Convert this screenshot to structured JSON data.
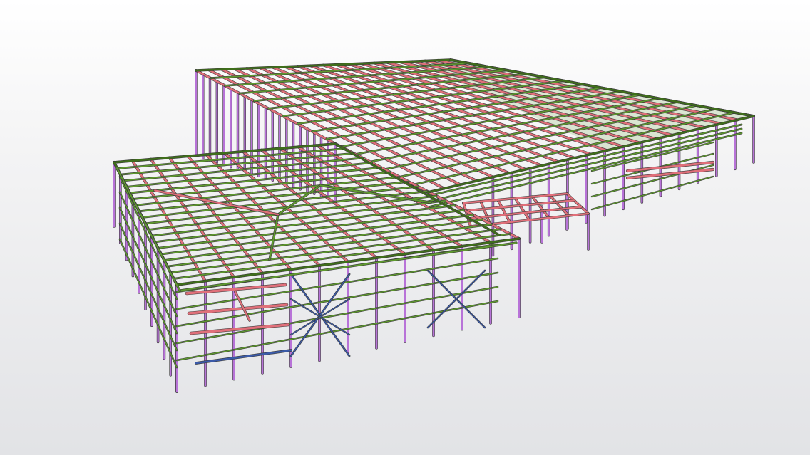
{
  "viewport": {
    "background_top": "#ffffff",
    "background_bottom": "#e2e3e6"
  },
  "member_colors": {
    "column": "#b873d8",
    "column_dark": "#7e3fa6",
    "girder": "#e0707a",
    "purlin": "#5f9a2f",
    "purlin_dark": "#3f6e1b",
    "brace": "#3b5aa8",
    "line": "#3a3a3a"
  },
  "structure": {
    "type": "steel-frame-building",
    "wings": [
      {
        "name": "back-wing",
        "bays_long": 20,
        "bays_deep": 8
      },
      {
        "name": "front-left-wing",
        "bays_long": 12,
        "bays_deep": 10
      }
    ]
  }
}
